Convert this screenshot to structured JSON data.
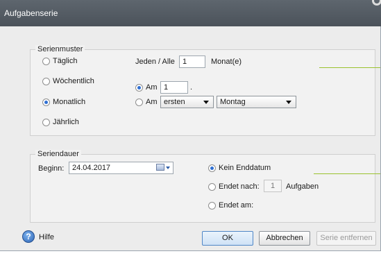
{
  "window": {
    "title": "Aufgabenserie"
  },
  "pattern": {
    "legend": "Serienmuster",
    "options": [
      "Täglich",
      "Wöchentlich",
      "Monatlich",
      "Jährlich"
    ],
    "selected": "Monatlich",
    "every_label": "Jeden / Alle",
    "every_value": "1",
    "every_unit": "Monat(e)",
    "am1_label": "Am",
    "am1_value": "1",
    "am1_suffix": ".",
    "am2_label": "Am",
    "am2_ordinal": "ersten",
    "am2_weekday": "Montag"
  },
  "duration": {
    "legend": "Seriendauer",
    "begin_label": "Beginn:",
    "begin_value": "24.04.2017",
    "no_end_label": "Kein Enddatum",
    "end_after_label": "Endet nach:",
    "end_after_value": "1",
    "end_after_unit": "Aufgaben",
    "end_on_label": "Endet am:"
  },
  "footer": {
    "help_glyph": "?",
    "help_label": "Hilfe",
    "ok_label": "OK",
    "cancel_label": "Abbrechen",
    "remove_label": "Serie entfernen"
  },
  "colors": {
    "accent_line": "#9ac12d",
    "title_bar": "#555c64",
    "radio_selected": "#2f6fd2"
  }
}
